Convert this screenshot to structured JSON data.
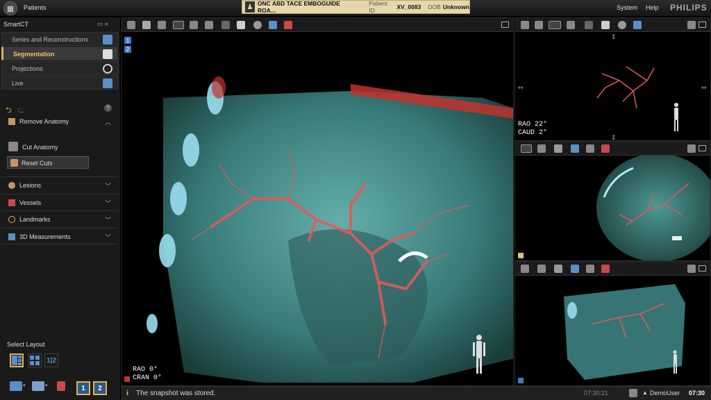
{
  "topbar": {
    "patients_label": "Patients",
    "exam_title": "ONC ABD TACE EMBOGUIDE ROA...",
    "patient_id_label": "Patient ID",
    "patient_id": "XV_0083",
    "dob_label": "DOB",
    "dob": "Unknown",
    "system_label": "System",
    "help_label": "Help",
    "brand": "PHILIPS"
  },
  "sidebar": {
    "app_title": "SmartCT",
    "nav": [
      {
        "label": "Series and Reconstructions",
        "icon": "series-cube-icon"
      },
      {
        "label": "Segmentation",
        "icon": "segmentation-cube-icon"
      },
      {
        "label": "Projections",
        "icon": "rotate-arrows-icon"
      },
      {
        "label": "Live",
        "icon": "live-cube-icon"
      }
    ],
    "remove_anatomy": "Remove Anatomy",
    "cut_anatomy": "Cut Anatomy",
    "reset_cuts": "Reset Cuts",
    "sections": [
      {
        "label": "Lesions",
        "icon": "lesion-icon"
      },
      {
        "label": "Vessels",
        "icon": "vessel-icon"
      },
      {
        "label": "Landmarks",
        "icon": "crosshair-icon"
      },
      {
        "label": "3D Measurements",
        "icon": "measure-cube-icon"
      }
    ],
    "select_layout": "Select Layout",
    "layout_option_3": "1|2",
    "viewport_buttons": [
      "1",
      "2"
    ]
  },
  "main_view": {
    "viewport_numbers": [
      "1",
      "2"
    ],
    "angle_line1": "RAO  0°",
    "angle_line2": "CRAN  0°"
  },
  "view2": {
    "angle_line1": "RAO 22°",
    "angle_line2": "CAUD  2°"
  },
  "status": {
    "message": "The snapshot was stored.",
    "snapshot_time": "07:30:21",
    "user": "DemoUser",
    "clock": "07:30"
  },
  "colors": {
    "accent": "#e4b54b",
    "vessel": "#e05a5a",
    "tissue": "#5fb5b0",
    "viewport_marker": "#3e7cc4"
  }
}
